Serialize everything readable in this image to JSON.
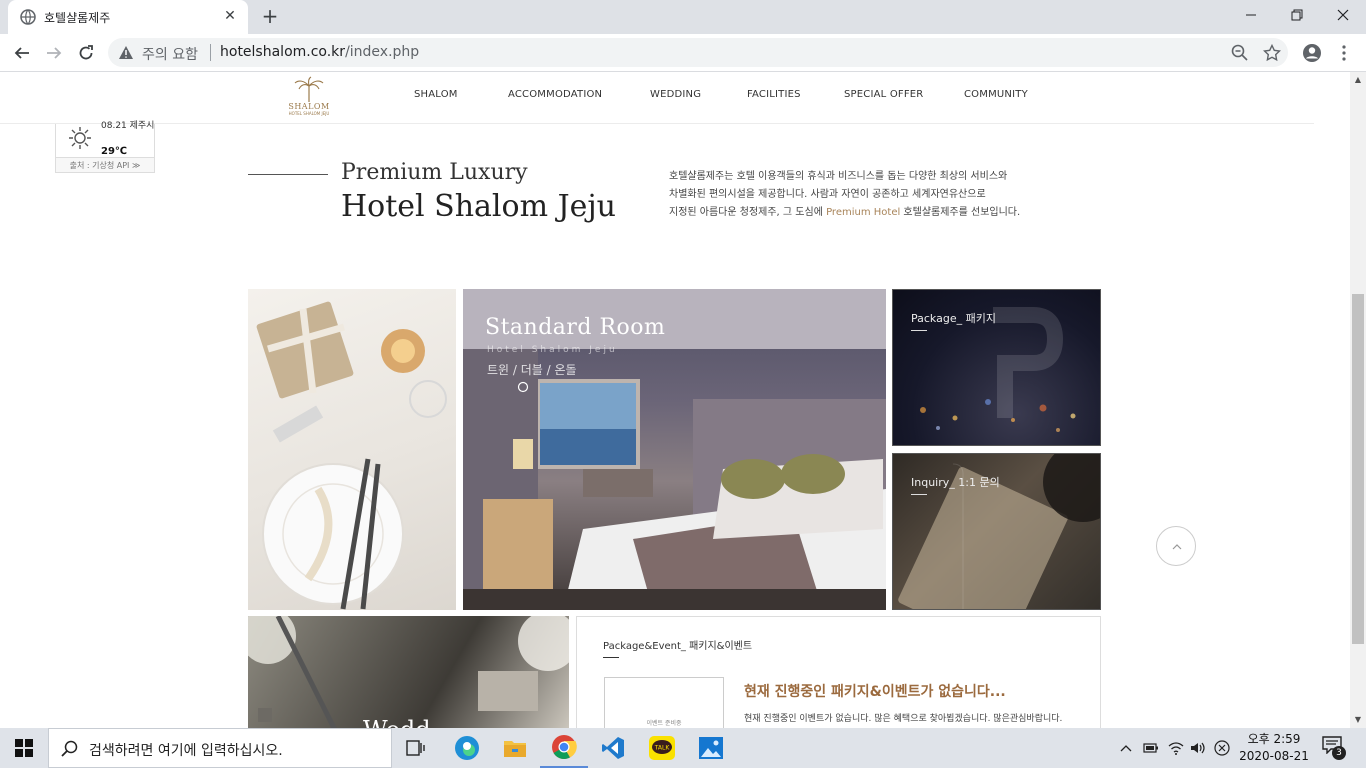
{
  "browser": {
    "tab_title": "호텔샬롬제주",
    "security_label": "주의 요함",
    "url_host": "hotelshalom.co.kr",
    "url_path": "/index.php"
  },
  "site": {
    "logo_text": "SHALOM",
    "logo_sub": "HOTEL SHALOM JEJU",
    "nav": [
      "SHALOM",
      "ACCOMMODATION",
      "WEDDING",
      "FACILITIES",
      "SPECIAL OFFER",
      "COMMUNITY"
    ]
  },
  "weather": {
    "datetime": "08.21 제주시",
    "temperature": "29℃",
    "source": "출처 : 기상청 API ≫"
  },
  "intro": {
    "title_small": "Premium Luxury",
    "title_big": "Hotel Shalom Jeju",
    "desc_line1": "호텔샬롬제주는 호텔 이용객들의 휴식과 비즈니스를 돕는 다양한 최상의 서비스와",
    "desc_line2": "차별화된 편의시설을 제공합니다. 사람과 자연이 공존하고 세계자연유산으로",
    "desc_line3_pre": "지정된 아름다운 청정제주, 그 도심에 ",
    "desc_line3_accent": "Premium Hotel",
    "desc_line3_post": " 호텔샬롬제주를 선보입니다."
  },
  "tiles": {
    "room_title": "Standard Room",
    "room_sub": "Hotel Shalom Jeju",
    "room_types": "트윈 / 더블 / 온돌",
    "package_label": "Package_ 패키지",
    "inquiry_label": "Inquiry_ 1:1 문의",
    "wedding_label": "Wedd"
  },
  "events": {
    "title": "Package&Event_ 패키지&이벤트",
    "thumb_text": "이벤트 준비중",
    "heading": "현재 진행중인 패키지&이벤트가 없습니다...",
    "text": "현재 진행중인 이벤트가 없습니다. 많은 혜택으로 찾아뵙겠습니다. 많은관심바랍니다."
  },
  "taskbar": {
    "search_placeholder": "검색하려면 여기에 입력하십시오.",
    "time": "오후 2:59",
    "date": "2020-08-21",
    "notification_count": "3"
  },
  "colors": {
    "accent": "#a8845a",
    "heading_brown": "#9b6a3e",
    "tab_strip": "#dee1e6",
    "taskbar": "#dfe3e9"
  }
}
